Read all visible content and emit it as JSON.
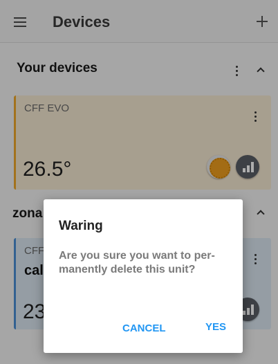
{
  "appbar": {
    "title": "Devices"
  },
  "sections": [
    {
      "title": "Your devices",
      "card": {
        "label": "CFF EVO",
        "temperature": "26.5°"
      }
    },
    {
      "title": "zona",
      "card": {
        "label": "CFF",
        "name": "cal",
        "temperature": "23"
      }
    }
  ],
  "dialog": {
    "title": "Waring",
    "message": "Are you sure you want to per-manently delete this unit?",
    "cancel_label": "CANCEL",
    "yes_label": "YES"
  },
  "colors": {
    "accent": "#2196f3",
    "card_warm": "#f7ead3",
    "card_warm_border": "#f0a92a",
    "card_cool": "#dce8f2",
    "card_cool_border": "#4a8fd6"
  },
  "icons": [
    "menu-icon",
    "plus-icon",
    "more-vert-icon",
    "chevron-up-icon",
    "sun-icon",
    "bar-chart-icon"
  ]
}
